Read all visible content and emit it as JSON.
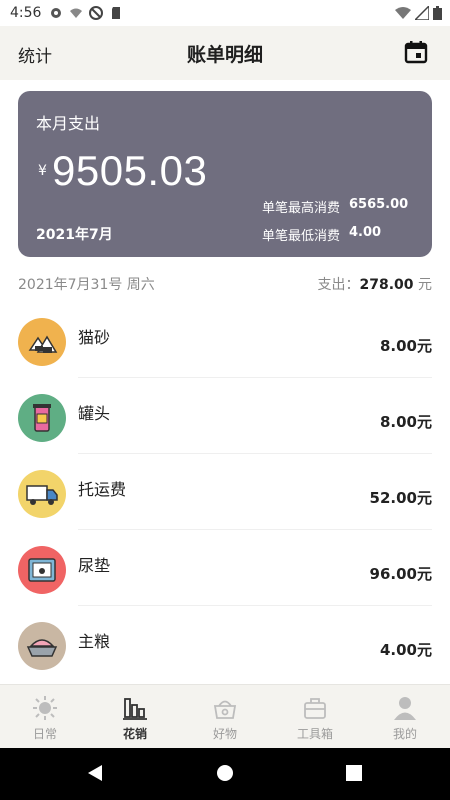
{
  "status_bar": {
    "time": "4:56"
  },
  "app_bar": {
    "left_label": "统计",
    "title": "账单明细"
  },
  "summary": {
    "label": "本月支出",
    "currency": "¥",
    "amount": "9505.03",
    "month": "2021年7月",
    "max_label": "单笔最高消费",
    "max_value": "6565.00",
    "min_label": "单笔最低消费",
    "min_value": "4.00",
    "card_color": "#706e7f"
  },
  "date_row": {
    "date": "2021年7月31号 周六",
    "spend_label": "支出：",
    "spend_value": "278.00",
    "unit": " 元"
  },
  "items": [
    {
      "name": "猫砂",
      "price": "8.00元",
      "icon": "cat-litter-icon",
      "bg": "#f0b24e"
    },
    {
      "name": "罐头",
      "price": "8.00元",
      "icon": "canned-food-icon",
      "bg": "#5fae84"
    },
    {
      "name": "托运费",
      "price": "52.00元",
      "icon": "truck-icon",
      "bg": "#f2d46a"
    },
    {
      "name": "尿垫",
      "price": "96.00元",
      "icon": "pet-pad-icon",
      "bg": "#f06464"
    },
    {
      "name": "主粮",
      "price": "4.00元",
      "icon": "food-bowl-icon",
      "bg": "#c9b7a3"
    }
  ],
  "tabs": [
    {
      "label": "日常",
      "icon": "sun-icon",
      "active": false
    },
    {
      "label": "花销",
      "icon": "bar-chart-icon",
      "active": true
    },
    {
      "label": "好物",
      "icon": "basket-icon",
      "active": false
    },
    {
      "label": "工具箱",
      "icon": "toolbox-icon",
      "active": false
    },
    {
      "label": "我的",
      "icon": "person-icon",
      "active": false
    }
  ]
}
